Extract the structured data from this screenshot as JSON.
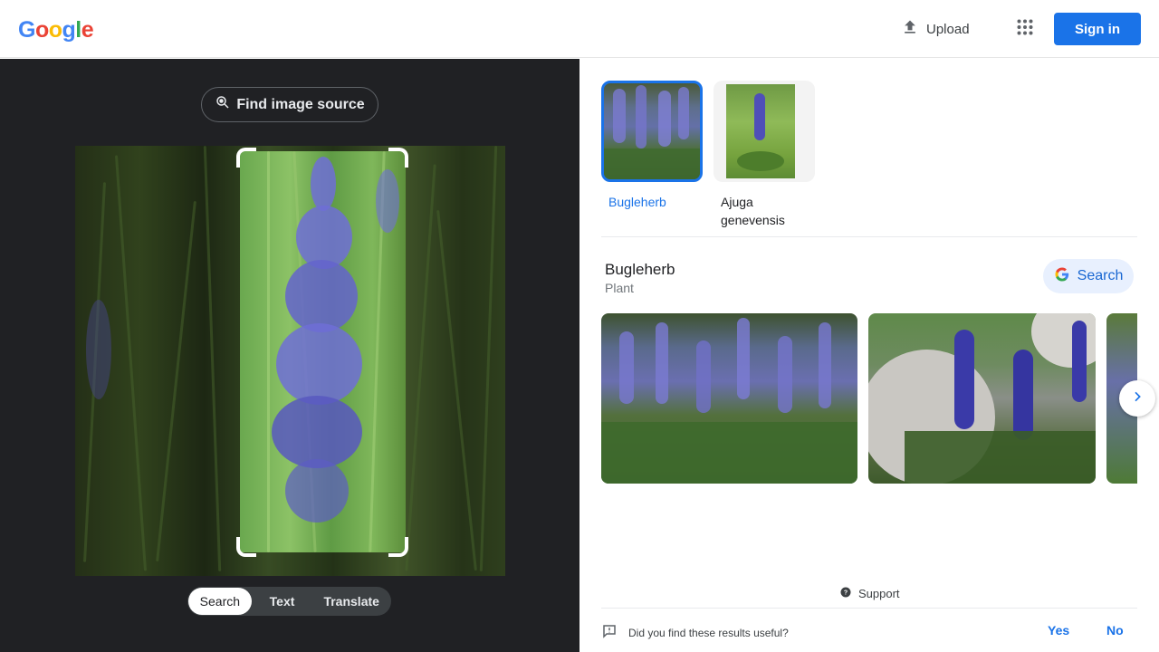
{
  "header": {
    "logo": [
      "G",
      "o",
      "o",
      "g",
      "l",
      "e"
    ],
    "upload_label": "Upload",
    "signin_label": "Sign in"
  },
  "left": {
    "find_source_label": "Find image source",
    "modes": [
      "Search",
      "Text",
      "Translate"
    ],
    "active_mode": "Search"
  },
  "right": {
    "entities": [
      {
        "label": "Bugleherb",
        "selected": true
      },
      {
        "label": "Ajuga genevensis",
        "selected": false
      }
    ],
    "entity": {
      "title": "Bugleherb",
      "subtitle": "Plant",
      "search_label": "Search"
    },
    "support_label": "Support",
    "feedback": {
      "question": "Did you find these results useful?",
      "yes": "Yes",
      "no": "No"
    }
  },
  "colors": {
    "brand_blue": "#1a73e8",
    "left_bg": "#202124",
    "chip_bg": "#e8f0fe"
  }
}
